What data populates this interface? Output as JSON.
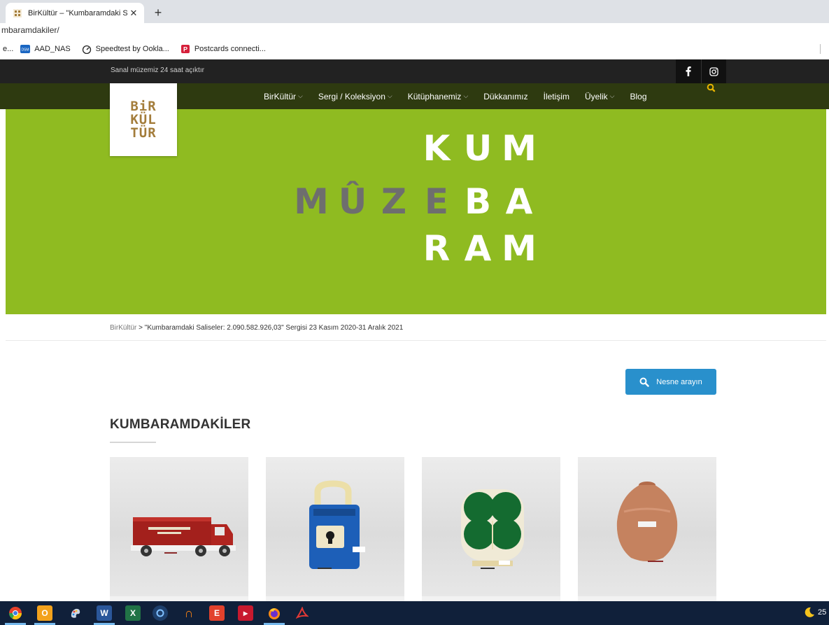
{
  "browser": {
    "tab_title": "BirKültür – \"Kumbaramdaki Salise",
    "close_glyph": "✕",
    "new_tab_glyph": "+",
    "url": "mbaramdakiler/",
    "bookmarks": [
      {
        "label": "AAD_NAS",
        "icon": "nas-icon"
      },
      {
        "label": "Speedtest by Ookla...",
        "icon": "speedtest-icon"
      },
      {
        "label": "Postcards connecti...",
        "icon": "postcards-icon"
      }
    ],
    "bookmark_prefix": "e..."
  },
  "site": {
    "tagline": "Sanal müzemiz 24 saat açıktır",
    "social": [
      "facebook-icon",
      "instagram-icon"
    ],
    "logo_lines": [
      "BiR",
      "KÜL",
      "TÜR"
    ],
    "nav": [
      {
        "label": "BirKültür",
        "dropdown": true
      },
      {
        "label": "Sergi / Koleksiyon",
        "dropdown": true
      },
      {
        "label": "Kütüphanemiz",
        "dropdown": true
      },
      {
        "label": "Dükkanımız",
        "dropdown": false
      },
      {
        "label": "İletişim",
        "dropdown": false
      },
      {
        "label": "Üyelik",
        "dropdown": true
      },
      {
        "label": "Blog",
        "dropdown": false
      }
    ],
    "chevron": "⌵"
  },
  "hero": {
    "letters": [
      [
        "",
        "",
        "",
        "K",
        "U",
        "M"
      ],
      [
        "M",
        "Û",
        "Z",
        "E",
        "B",
        "A"
      ],
      [
        "",
        "",
        "",
        "R",
        "A",
        "M"
      ]
    ],
    "gray_cells": [
      "1-0",
      "1-1",
      "1-2",
      "1-3"
    ],
    "colors": {
      "background": "#8fbb21",
      "white_text": "#ffffff",
      "gray_text": "#6e6e6e"
    }
  },
  "breadcrumb": {
    "home": "BirKültür",
    "separator": " > ",
    "current": "\"Kumbaramdaki Saliseler: 2.090.582.926,03\" Sergisi 23 Kasım 2020-31 Aralık 2021"
  },
  "search_button": {
    "label": "Nesne arayın",
    "color": "#2990cc"
  },
  "section": {
    "title": "KUMBARAMDAKİLER"
  },
  "cards": [
    {
      "subject": "red-truck-money-box"
    },
    {
      "subject": "blue-padlock-money-box"
    },
    {
      "subject": "green-clover-money-box"
    },
    {
      "subject": "clay-pot-money-box"
    }
  ],
  "taskbar": {
    "apps": [
      "chrome-icon",
      "outlook-icon",
      "paint-icon",
      "word-icon",
      "excel-icon",
      "camera-icon",
      "app-icon",
      "app-icon-2",
      "app-icon-3",
      "firefox-icon",
      "acrobat-icon"
    ],
    "clock_partial": "25"
  }
}
